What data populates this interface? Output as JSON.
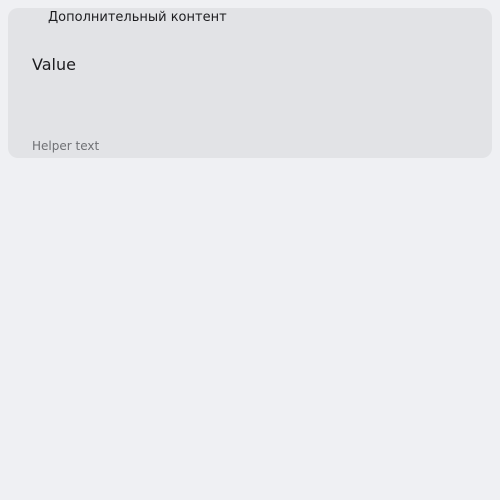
{
  "field": {
    "content_label": "Дополнительный контент",
    "value": "Value",
    "helper_text": "Helper text",
    "icon": "eye-icon"
  },
  "colors": {
    "background": "#eff0f3",
    "field_background": "#e2e3e6",
    "text_primary": "#1c1c1f",
    "text_secondary": "#6f7074"
  }
}
